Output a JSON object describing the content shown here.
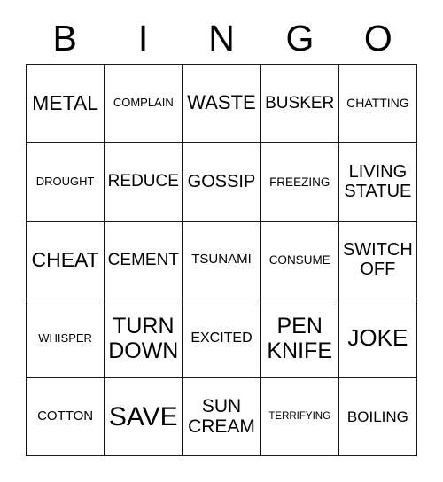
{
  "card": {
    "title": "BINGO",
    "header_letters": [
      "B",
      "I",
      "N",
      "G",
      "O"
    ],
    "grid_rows": 5,
    "grid_columns": 5,
    "border_color": "#1a1a1a",
    "background_color": "#ffffff",
    "text_color": "#000000",
    "cells": [
      {
        "text": "METAL",
        "font_size": 23,
        "lines": 1,
        "row": 1,
        "column": "B"
      },
      {
        "text": "COMPLAIN",
        "font_size": 13,
        "lines": 1,
        "row": 1,
        "column": "I"
      },
      {
        "text": "WASTE",
        "font_size": 22,
        "lines": 1,
        "row": 1,
        "column": "N"
      },
      {
        "text": "BUSKER",
        "font_size": 19,
        "lines": 1,
        "row": 1,
        "column": "G"
      },
      {
        "text": "CHATTING",
        "font_size": 14,
        "lines": 1,
        "row": 1,
        "column": "O"
      },
      {
        "text": "DROUGHT",
        "font_size": 13,
        "lines": 1,
        "row": 2,
        "column": "B"
      },
      {
        "text": "REDUCE",
        "font_size": 19,
        "lines": 1,
        "row": 2,
        "column": "I"
      },
      {
        "text": "GOSSIP",
        "font_size": 20,
        "lines": 1,
        "row": 2,
        "column": "N"
      },
      {
        "text": "FREEZING",
        "font_size": 13.5,
        "lines": 1,
        "row": 2,
        "column": "G"
      },
      {
        "text": "LIVING\nSTATUE",
        "font_size": 20,
        "lines": 2,
        "row": 2,
        "column": "O"
      },
      {
        "text": "CHEAT",
        "font_size": 23,
        "lines": 1,
        "row": 3,
        "column": "B"
      },
      {
        "text": "CEMENT",
        "font_size": 19,
        "lines": 1,
        "row": 3,
        "column": "I"
      },
      {
        "text": "TSUNAMI",
        "font_size": 15,
        "lines": 1,
        "row": 3,
        "column": "N"
      },
      {
        "text": "CONSUME",
        "font_size": 13.5,
        "lines": 1,
        "row": 3,
        "column": "G"
      },
      {
        "text": "SWITCH\nOFF",
        "font_size": 20,
        "lines": 2,
        "row": 3,
        "column": "O"
      },
      {
        "text": "WHISPER",
        "font_size": 13,
        "lines": 1,
        "row": 4,
        "column": "B"
      },
      {
        "text": "TURN\nDOWN",
        "font_size": 25,
        "lines": 2,
        "row": 4,
        "column": "I"
      },
      {
        "text": "EXCITED",
        "font_size": 16,
        "lines": 1,
        "row": 4,
        "column": "N"
      },
      {
        "text": "PEN\nKNIFE",
        "font_size": 25,
        "lines": 2,
        "row": 4,
        "column": "G"
      },
      {
        "text": "JOKE",
        "font_size": 26,
        "lines": 1,
        "row": 4,
        "column": "O"
      },
      {
        "text": "COTTON",
        "font_size": 15,
        "lines": 1,
        "row": 5,
        "column": "B"
      },
      {
        "text": "SAVE",
        "font_size": 30,
        "lines": 1,
        "row": 5,
        "column": "I"
      },
      {
        "text": "SUN\nCREAM",
        "font_size": 21,
        "lines": 2,
        "row": 5,
        "column": "N"
      },
      {
        "text": "TERRIFYING",
        "font_size": 11.5,
        "lines": 1,
        "row": 5,
        "column": "G"
      },
      {
        "text": "BOILING",
        "font_size": 17,
        "lines": 1,
        "row": 5,
        "column": "O"
      }
    ]
  }
}
